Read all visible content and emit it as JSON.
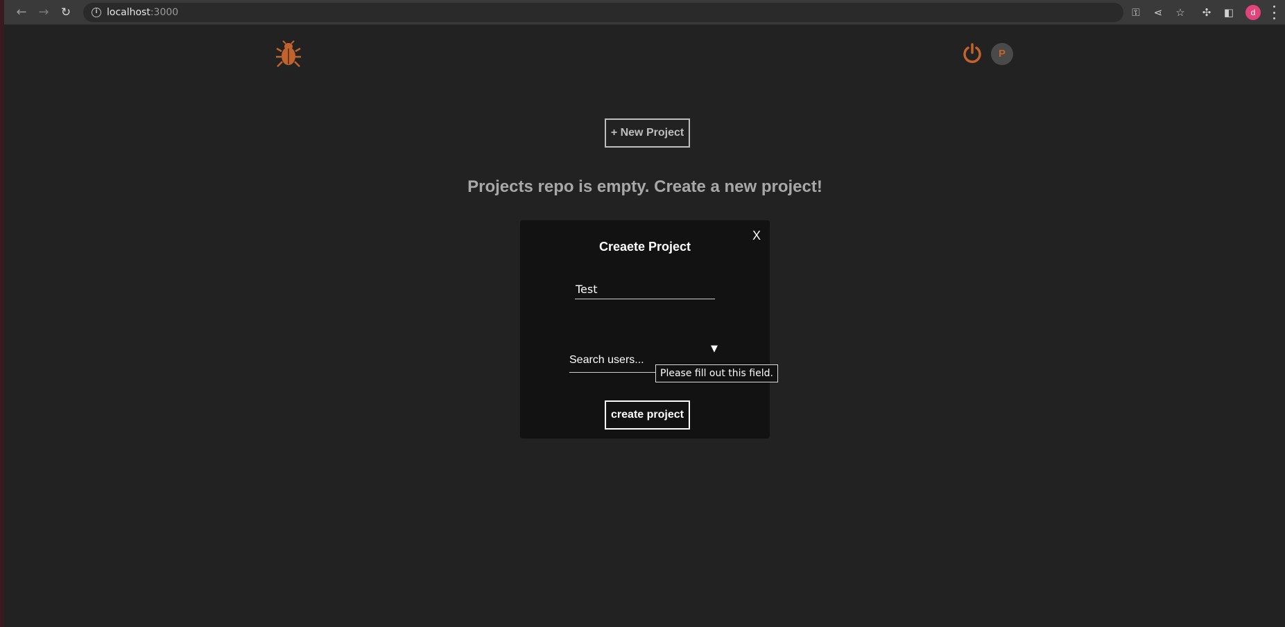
{
  "browser": {
    "url_host": "localhost",
    "url_port": ":3000",
    "profile_initial": "d",
    "icons": [
      "back-arrow-icon",
      "forward-arrow-icon",
      "reload-icon",
      "info-icon",
      "key-icon",
      "share-icon",
      "star-icon",
      "puzzle-icon",
      "side-panel-icon",
      "kebab-menu-icon"
    ]
  },
  "header": {
    "logo_icon": "bug-icon",
    "logout_icon": "power-icon",
    "avatar_initial": "P",
    "accent_color": "#c2622d"
  },
  "main": {
    "new_project_label": "+ New Project",
    "empty_message": "Projects repo is empty. Create a new project!"
  },
  "modal": {
    "title": "Creaete Project",
    "close_label": "X",
    "project_name_value": "Test",
    "users_placeholder": "Search users...",
    "dropdown_arrow": "▼",
    "validation_message": "Please fill out this field.",
    "submit_label": "create project"
  }
}
